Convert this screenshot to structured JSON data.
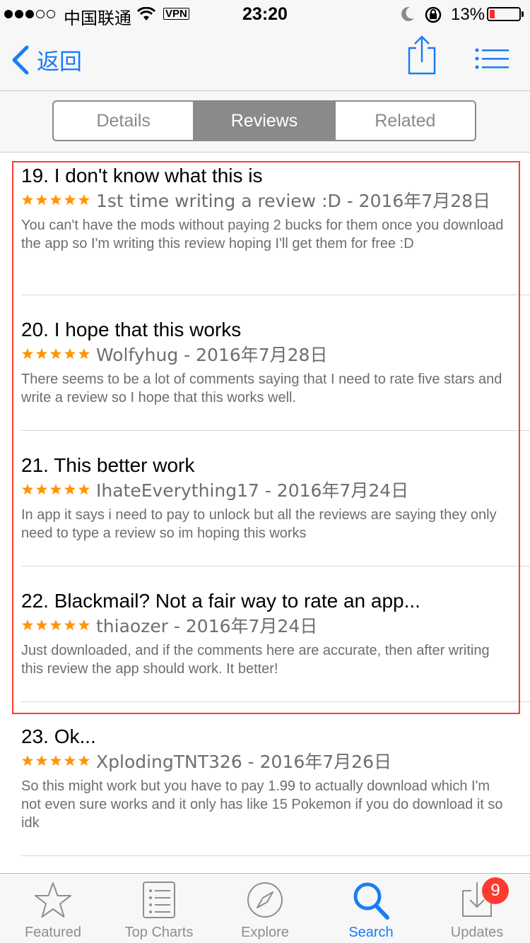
{
  "status_bar": {
    "carrier": "中国联通",
    "vpn": "VPN",
    "time": "23:20",
    "battery_percent": "13%",
    "battery_level": 0.13,
    "battery_color": "#ff2d2d"
  },
  "nav": {
    "back_label": "返回",
    "accent": "#1a7cf5"
  },
  "segments": [
    {
      "label": "Details",
      "active": false
    },
    {
      "label": "Reviews",
      "active": true
    },
    {
      "label": "Related",
      "active": false
    }
  ],
  "reviews": [
    {
      "title": "19. I don't know what this is",
      "rating": 5,
      "meta": "1st time writing a review :D - 2016年7月28日",
      "body": "You can't have the mods without paying 2 bucks for them once you download the app so I'm writing this review hoping I'll get them for free :D"
    },
    {
      "title": "20. I hope that this works",
      "rating": 5,
      "meta": "Wolfyhug - 2016年7月28日",
      "body": "There seems to be a lot of comments saying that I need to rate five stars and write a review so I hope that this works well."
    },
    {
      "title": "21. This better work",
      "rating": 5,
      "meta": "IhateEverything17 - 2016年7月24日",
      "body": "In app it says i need to pay to unlock but all the reviews are saying they only need to type a review so im hoping this works"
    },
    {
      "title": "22. Blackmail? Not a fair way to rate an app...",
      "rating": 5,
      "meta": "thiaozer - 2016年7月24日",
      "body": "Just downloaded, and if the comments here are accurate, then after writing this review the app should work. It better!"
    },
    {
      "title": "23. Ok...",
      "rating": 5,
      "meta": "XplodingTNT326 - 2016年7月26日",
      "body": "So this might work but you have to pay 1.99 to actually download which I'm not even sure works and it only has like 15 Pokemon if you do download it so idk"
    }
  ],
  "star_color": "#ff9500",
  "highlight_color": "#ff3b30",
  "tabs": [
    {
      "label": "Featured",
      "icon": "star-icon",
      "active": false
    },
    {
      "label": "Top Charts",
      "icon": "list-icon",
      "active": false
    },
    {
      "label": "Explore",
      "icon": "compass-icon",
      "active": false
    },
    {
      "label": "Search",
      "icon": "search-icon",
      "active": true
    },
    {
      "label": "Updates",
      "icon": "download-icon",
      "active": false
    }
  ],
  "updates_badge": "9"
}
